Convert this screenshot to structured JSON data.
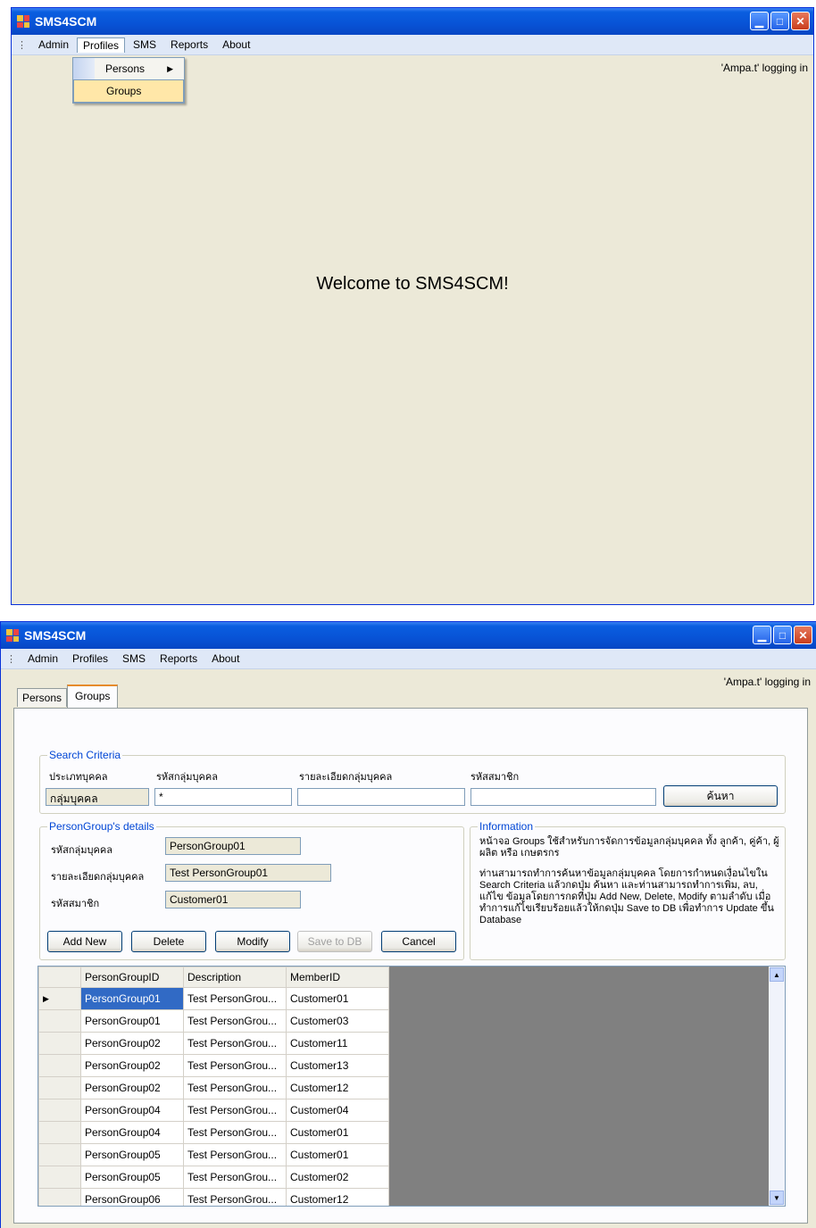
{
  "app_title": "SMS4SCM",
  "menu": [
    "Admin",
    "Profiles",
    "SMS",
    "Reports",
    "About"
  ],
  "logging_status": "'Ampa.t' logging in",
  "screen1": {
    "dropdown": [
      "Persons",
      "Groups"
    ],
    "welcome": "Welcome to SMS4SCM!"
  },
  "screen2": {
    "tabs": [
      "Persons",
      "Groups"
    ],
    "search": {
      "title": "Search Criteria",
      "labels": [
        "ประเภทบุคคล",
        "รหัสกลุ่มบุคคล",
        "รายละเอียดกลุ่มบุคคล",
        "รหัสสมาชิก"
      ],
      "type_value": "กลุ่มบุคคล",
      "group_id_value": "*",
      "description_value": "",
      "member_value": "",
      "search_button": "ค้นหา"
    },
    "details": {
      "title": "PersonGroup's details",
      "labels": [
        "รหัสกลุ่มบุคคล",
        "รายละเอียดกลุ่มบุคคล",
        "รหัสสมาชิก"
      ],
      "values": [
        "PersonGroup01",
        "Test PersonGroup01",
        "Customer01"
      ],
      "buttons": [
        "Add New",
        "Delete",
        "Modify",
        "Save to DB",
        "Cancel"
      ]
    },
    "information": {
      "title": "Information",
      "paragraph1": "หน้าจอ Groups ใช้สำหรับการจัดการข้อมูลกลุ่มบุคคล ทั้ง ลูกค้า, คู่ค้า, ผู้ผลิต หรือ เกษตรกร",
      "paragraph2": "ท่านสามารถทำการค้นหาข้อมูลกลุ่มบุคคล โดยการกำหนดเงื่อนไขใน Search Criteria แล้วกดปุ่ม ค้นหา และท่านสามารถทำการเพิ่ม, ลบ, แก้ไข ข้อมูลโดยการกดที่ปุ่ม Add New, Delete, Modify ตามลำดับ เมื่อทำการแก้ไขเรียบร้อยแล้วให้กดปุ่ม Save to DB เพื่อทำการ Update ขึ้น Database"
    },
    "grid": {
      "columns": [
        "PersonGroupID",
        "Description",
        "MemberID"
      ],
      "rows": [
        [
          "PersonGroup01",
          "Test PersonGrou...",
          "Customer01"
        ],
        [
          "PersonGroup01",
          "Test PersonGrou...",
          "Customer03"
        ],
        [
          "PersonGroup02",
          "Test PersonGrou...",
          "Customer11"
        ],
        [
          "PersonGroup02",
          "Test PersonGrou...",
          "Customer13"
        ],
        [
          "PersonGroup02",
          "Test PersonGrou...",
          "Customer12"
        ],
        [
          "PersonGroup04",
          "Test PersonGrou...",
          "Customer04"
        ],
        [
          "PersonGroup04",
          "Test PersonGrou...",
          "Customer01"
        ],
        [
          "PersonGroup05",
          "Test PersonGrou...",
          "Customer01"
        ],
        [
          "PersonGroup05",
          "Test PersonGrou...",
          "Customer02"
        ],
        [
          "PersonGroup06",
          "Test PersonGrou...",
          "Customer12"
        ]
      ]
    }
  }
}
